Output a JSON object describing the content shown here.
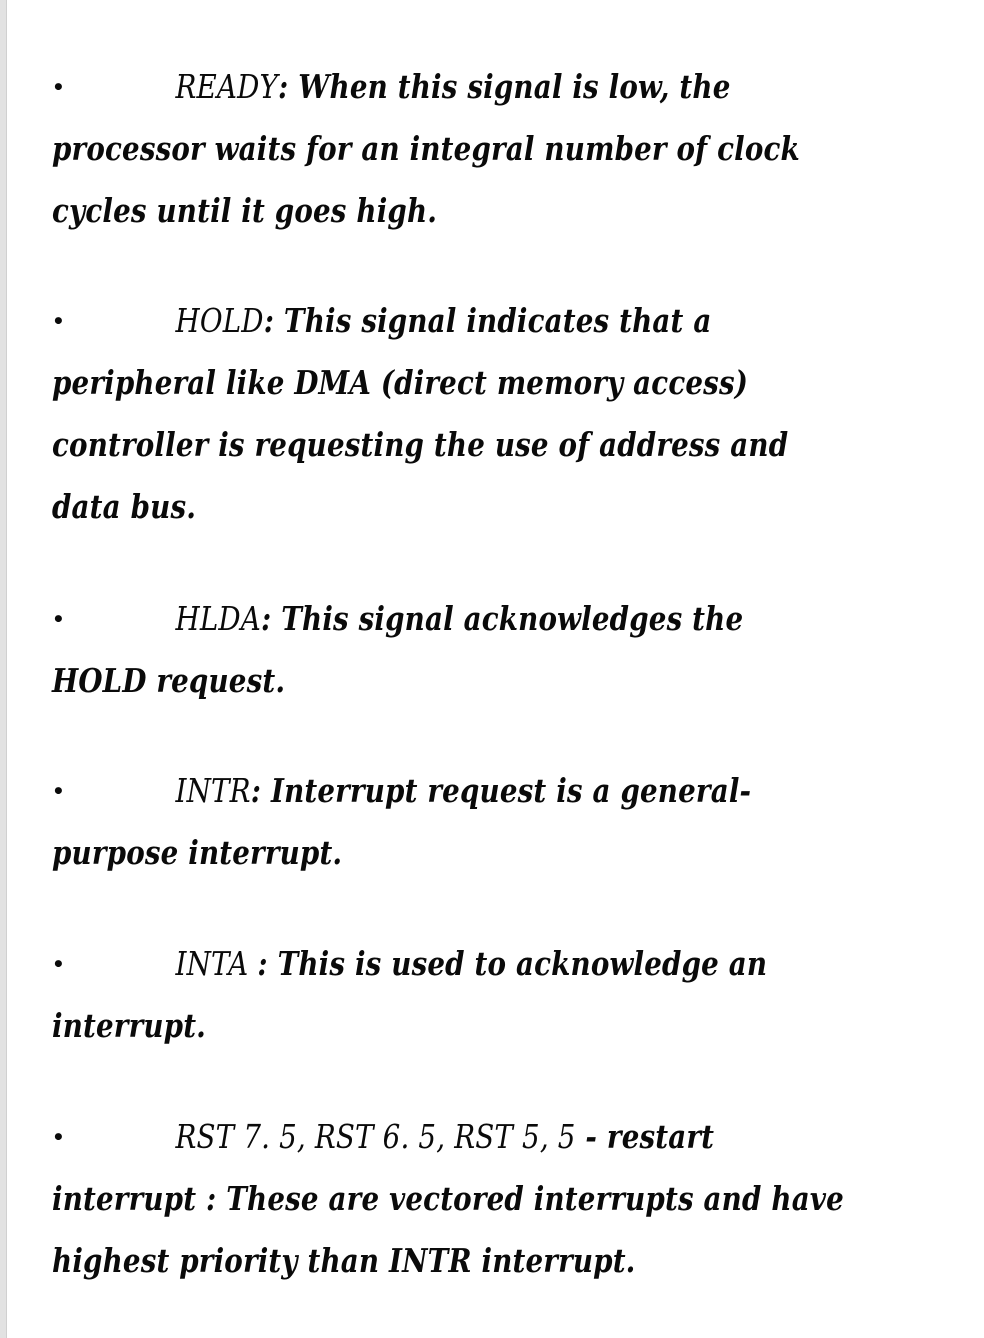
{
  "items": [
    {
      "bullet": "•",
      "term": "READY",
      "sep": ":",
      "lines": [
        " When this signal is low,  the",
        "processor waits for an integral number of clock",
        "cycles until it goes high."
      ]
    },
    {
      "bullet": "•",
      "term": "HOLD",
      "sep": ":",
      "lines": [
        " This signal indicates that a",
        "peripheral like DMA (direct memory access)",
        "controller is requesting the use of address and",
        "data bus."
      ]
    },
    {
      "bullet": "•",
      "term": "HLDA",
      "sep": ":",
      "lines": [
        " This signal acknowledges the",
        "HOLD request."
      ]
    },
    {
      "bullet": "•",
      "term": "INTR",
      "sep": ":",
      "lines": [
        " Interrupt request is a general-",
        "purpose interrupt."
      ]
    },
    {
      "bullet": "•",
      "term": "INTA ",
      "sep": ":",
      "lines": [
        " This is used to acknowledge an",
        "interrupt."
      ]
    },
    {
      "bullet": "•",
      "term": "RST 7. 5,  RST 6. 5,  RST 5, 5",
      "sep": "",
      "lines": [
        " - restart",
        "interrupt : These are vectored interrupts and have",
        "highest priority than INTR interrupt."
      ]
    }
  ]
}
